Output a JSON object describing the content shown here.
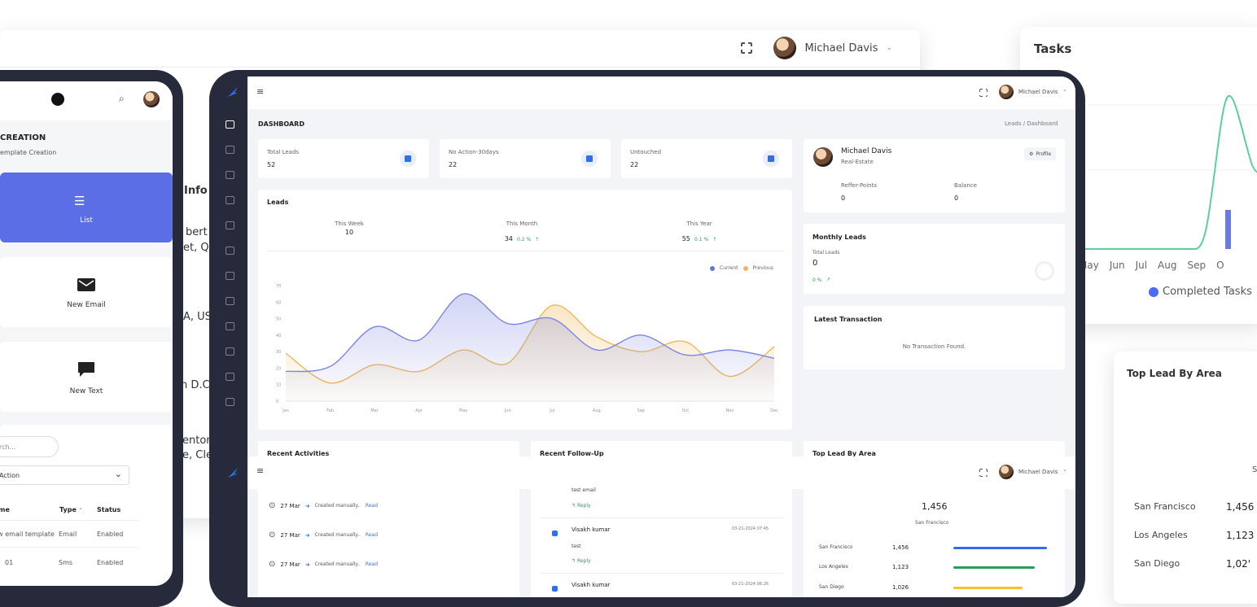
{
  "back_window": {
    "user_name": "Michael Davis",
    "info_heading": "Info",
    "fragments": [
      "bert",
      "et, Q",
      "A, US",
      "n D.C",
      "enton",
      "e, Cle"
    ]
  },
  "tasks_panel": {
    "title": "Tasks",
    "chart_data": {
      "type": "line",
      "categories": [
        "May",
        "Jun",
        "Jul",
        "Aug",
        "Sep",
        "O"
      ],
      "series": [
        {
          "name": "Completed Tasks",
          "values": [
            0,
            0,
            0,
            0,
            10,
            3
          ]
        }
      ],
      "legend_position": "bottom"
    },
    "legend_label": "Completed Tasks",
    "colors": {
      "line": "#5ccf9b",
      "bar": "#6b7be6",
      "legend_dot": "#4a6cf7"
    }
  },
  "top_lead_right": {
    "title": "Top Lead By Area",
    "partial": "S",
    "rows": [
      {
        "city": "San Francisco",
        "value": "1,456"
      },
      {
        "city": "Los Angeles",
        "value": "1,123"
      },
      {
        "city": "San Diego",
        "value": "1,02'"
      }
    ]
  },
  "phone": {
    "section_title": "CREATION",
    "section_subtitle": "emplate Creation",
    "tiles": [
      {
        "label": "List",
        "icon": "list-icon"
      },
      {
        "label": "New Email",
        "icon": "email-icon"
      },
      {
        "label": "New Text",
        "icon": "chat-icon"
      }
    ],
    "search_placeholder": "rch...",
    "action_select": "Action",
    "table_headers": [
      "lame",
      "Type",
      "Status"
    ],
    "rows": [
      {
        "name": "iew email template",
        "type": "Email",
        "status": "Enabled"
      },
      {
        "name": "01",
        "type": "Sms",
        "status": "Enabled"
      }
    ]
  },
  "dashboard": {
    "user_name": "Michael Davis",
    "page_title": "DASHBOARD",
    "breadcrumb": [
      "Leads",
      "Dashboard"
    ],
    "stats": [
      {
        "label": "Total Leads",
        "value": "52"
      },
      {
        "label": "No Action-30days",
        "value": "22"
      },
      {
        "label": "Untouched",
        "value": "22"
      }
    ],
    "leads": {
      "title": "Leads",
      "periods": [
        {
          "label": "This Week",
          "value": "10",
          "change": ""
        },
        {
          "label": "This Month",
          "value": "34",
          "change": "0.2 %"
        },
        {
          "label": "This Year",
          "value": "55",
          "change": "0.1 %"
        }
      ],
      "legend": [
        "Current",
        "Previous"
      ],
      "chart_data": {
        "type": "area",
        "categories": [
          "Jan",
          "Feb",
          "Mar",
          "Apr",
          "May",
          "Jun",
          "Jul",
          "Aug",
          "Sep",
          "Oct",
          "Nov",
          "Dec"
        ],
        "series": [
          {
            "name": "Current",
            "values": [
              18,
              21,
              45,
              37,
              65,
              47,
              50,
              31,
              40,
              28,
              31,
              26
            ]
          },
          {
            "name": "Previous",
            "values": [
              29,
              11,
              22,
              18,
              31,
              23,
              58,
              39,
              30,
              36,
              15,
              33
            ]
          }
        ],
        "yticks": [
          "0",
          "10",
          "20",
          "30",
          "40",
          "50",
          "60",
          "70"
        ],
        "ylim": [
          0,
          70
        ],
        "legend_position": "top-right"
      },
      "colors": {
        "current": "#7b87e0",
        "previous": "#f0b85a"
      }
    },
    "profile": {
      "name": "Michael Davis",
      "role": "Real-Estate",
      "profile_button": "Profile",
      "refer_label": "Reffer-Points",
      "refer_value": "0",
      "balance_label": "Balance",
      "balance_value": "0"
    },
    "monthly": {
      "title": "Monthly Leads",
      "total_label": "Total Leads",
      "total_value": "0",
      "change": "0 %"
    },
    "transaction": {
      "title": "Latest Transaction",
      "empty": "No Transaction Found."
    },
    "recent_activities": {
      "title": "Recent Activities",
      "items": [
        {
          "date": "27 Mar",
          "text": "Created manually..",
          "link": "Read"
        },
        {
          "date": "27 Mar",
          "text": "Created manually..",
          "link": "Read"
        },
        {
          "date": "27 Mar",
          "text": "Created manually..",
          "link": "Read"
        }
      ]
    },
    "followup": {
      "title": "Recent Follow-Up",
      "items": [
        {
          "name": "",
          "note": "test email",
          "reply": "Reply",
          "time": ""
        },
        {
          "name": "Visakh kumar",
          "note": "test",
          "reply": "Reply",
          "time": "03-21-2024 07:45"
        },
        {
          "name": "Visakh kumar",
          "note": "",
          "reply": "",
          "time": "03-21-2024 06:26"
        }
      ]
    },
    "top_lead": {
      "title": "Top Lead By Area",
      "headline_value": "1,456",
      "headline_city": "San Francisco",
      "rows": [
        {
          "city": "San Francisco",
          "value": "1,456",
          "color": "#2f6fed"
        },
        {
          "city": "Los Angeles",
          "value": "1,123",
          "color": "#2c9c5a"
        },
        {
          "city": "San Diego",
          "value": "1,026",
          "color": "#f2c230"
        }
      ]
    }
  }
}
